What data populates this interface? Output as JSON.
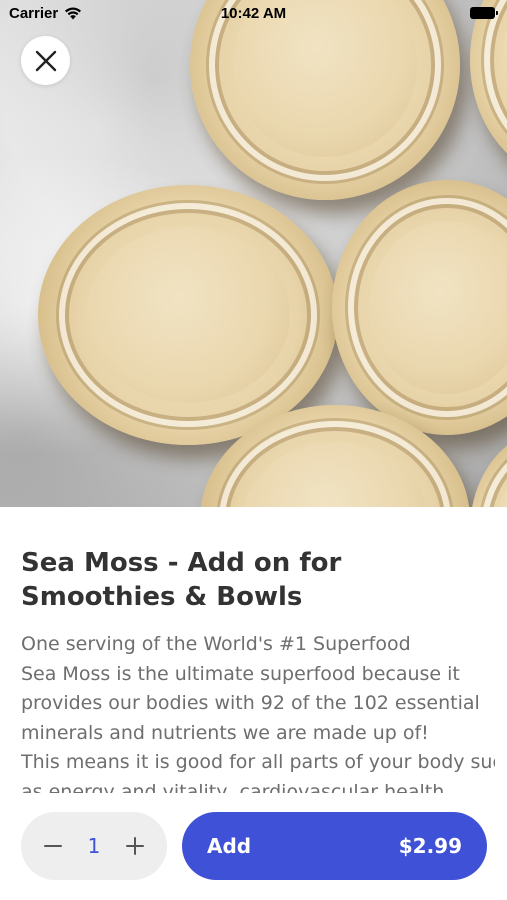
{
  "status_bar": {
    "carrier": "Carrier",
    "time": "10:42 AM"
  },
  "hero": {
    "icon": "sea-moss-jars-photo"
  },
  "product": {
    "title": "Sea Moss - Add on for Smoothies & Bowls",
    "description_lines": [
      "One serving of the World's #1 Superfood",
      "Sea Moss is the ultimate superfood because it",
      "provides our bodies with 92 of the 102 essential",
      "minerals and nutrients we are made up of!",
      "This means it is good for all parts of your body such",
      "as energy and vitality, cardiovascular health"
    ]
  },
  "cart": {
    "quantity": "1",
    "add_label": "Add",
    "price": "$2.99"
  },
  "colors": {
    "accent": "#3f51d6",
    "title": "#333333",
    "body_text": "#6e6e6e",
    "stepper_bg": "#eeeeee"
  }
}
